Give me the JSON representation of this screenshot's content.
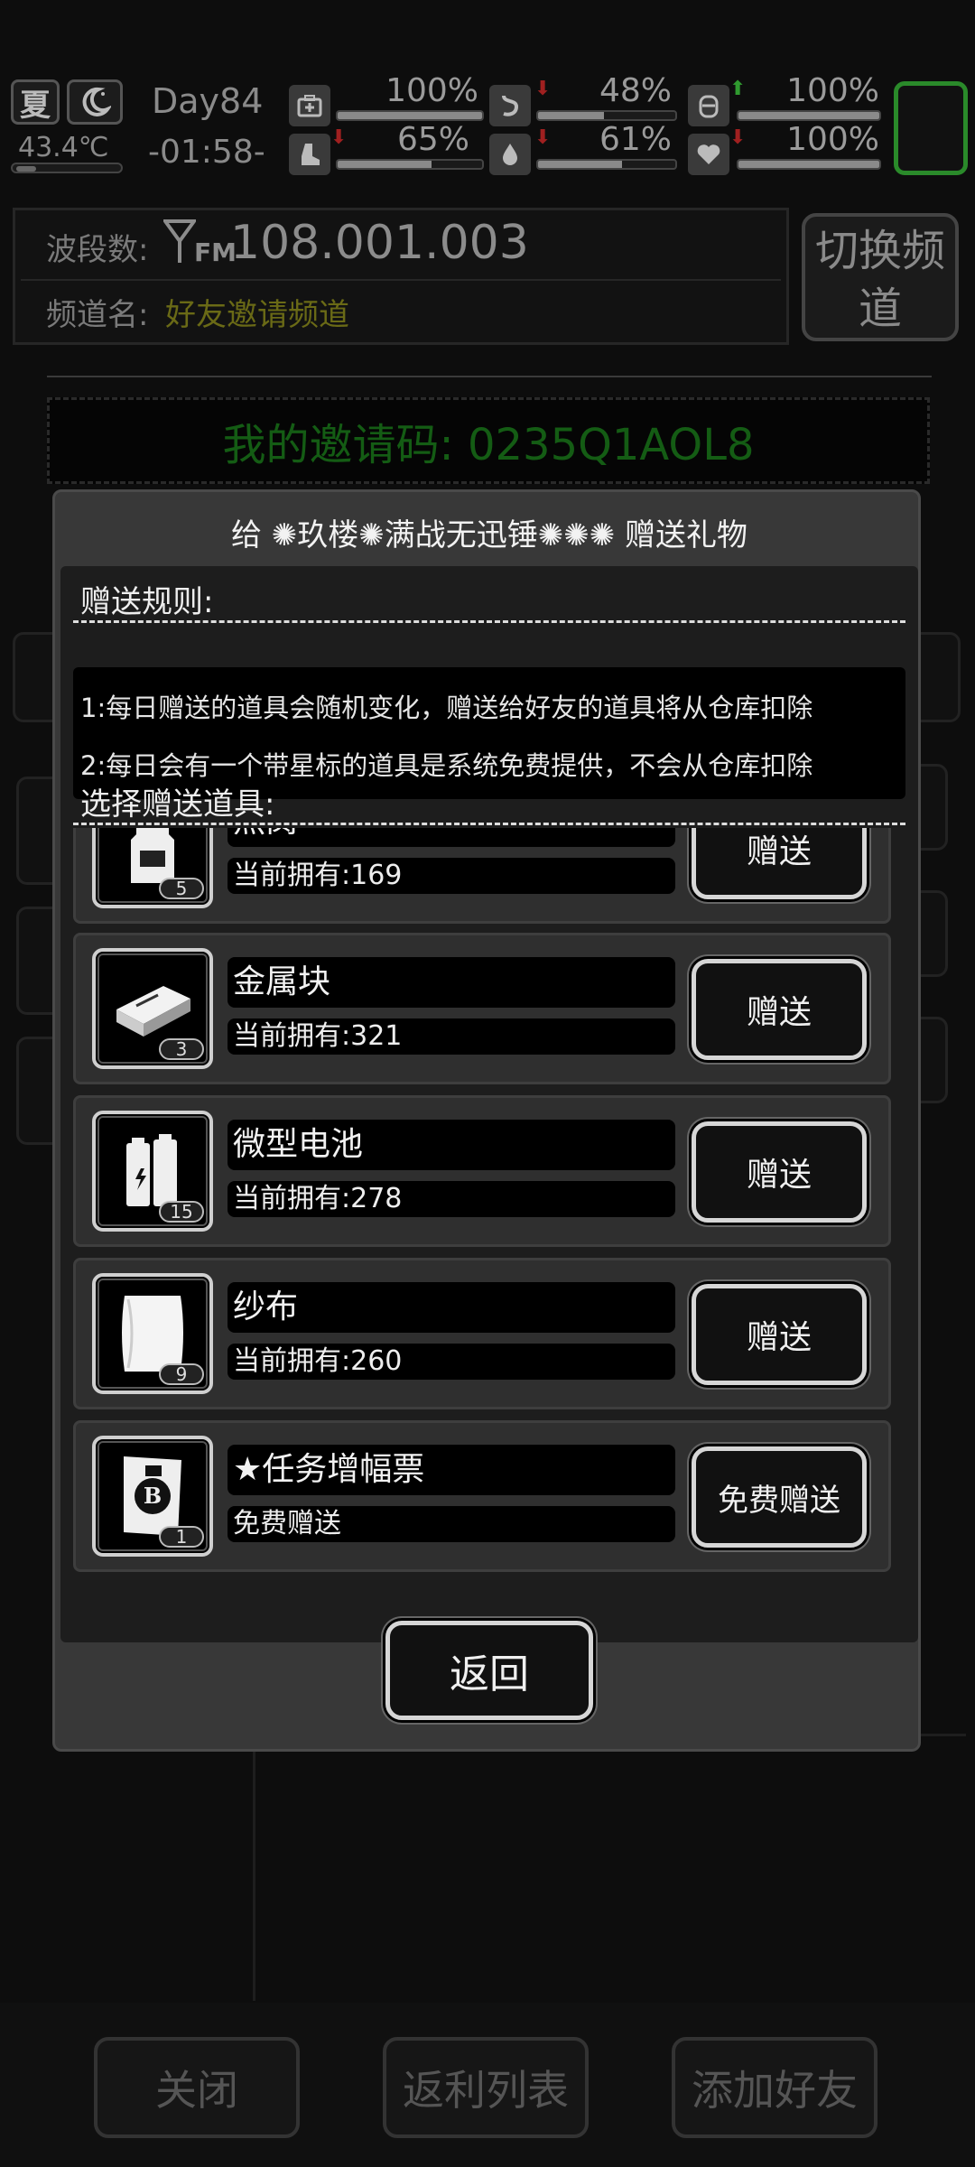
{
  "status": {
    "season": "夏",
    "temperature": "43.4℃",
    "day": "Day84",
    "clock": "-01:58-",
    "stats": [
      {
        "icon": "medkit-icon",
        "value": "100%",
        "fill": 1.0,
        "trend": ""
      },
      {
        "icon": "stomach-icon",
        "value": "48%",
        "fill": 0.48,
        "trend": "down"
      },
      {
        "icon": "battery-icon",
        "value": "100%",
        "fill": 1.0,
        "trend": "up"
      },
      {
        "icon": "boot-icon",
        "value": "65%",
        "fill": 0.65,
        "trend": "down"
      },
      {
        "icon": "water-drop-icon",
        "value": "61%",
        "fill": 0.61,
        "trend": "down"
      },
      {
        "icon": "heart-icon",
        "value": "100%",
        "fill": 1.0,
        "trend": "down"
      }
    ]
  },
  "radio": {
    "band_label": "波段数:",
    "fm_label": "FM",
    "frequency": "108.001.003",
    "channel_label": "频道名:",
    "channel_name": "好友邀请频道",
    "switch_label": "切换频道"
  },
  "invite_code": "我的邀请码: 0235Q1AOL8",
  "bottom_buttons": {
    "close": "关闭",
    "rebate": "返利列表",
    "add_friend": "添加好友"
  },
  "dialog": {
    "title": "给 ✺玖楼✺满战无迅锤✺✺✺ 赠送礼物",
    "rules_header": "赠送规则:",
    "rules": [
      "1:每日赠送的道具会随机变化，赠送给好友的道具将从仓库扣除",
      "2:每日会有一个带星标的道具是系统免费提供，不会从仓库扣除"
    ],
    "select_header": "选择赠送道具:",
    "items": [
      {
        "name": "燕窝",
        "owned": "当前拥有:169",
        "count": "5",
        "button": "赠送",
        "icon": "bottle-icon"
      },
      {
        "name": "金属块",
        "owned": "当前拥有:321",
        "count": "3",
        "button": "赠送",
        "icon": "metal-block-icon"
      },
      {
        "name": "微型电池",
        "owned": "当前拥有:278",
        "count": "15",
        "button": "赠送",
        "icon": "battery-cell-icon"
      },
      {
        "name": "纱布",
        "owned": "当前拥有:260",
        "count": "9",
        "button": "赠送",
        "icon": "gauze-icon"
      },
      {
        "name": "★任务增幅票",
        "owned": "免费赠送",
        "count": "1",
        "button": "免费赠送",
        "icon": "ticket-icon"
      }
    ],
    "back_label": "返回"
  }
}
